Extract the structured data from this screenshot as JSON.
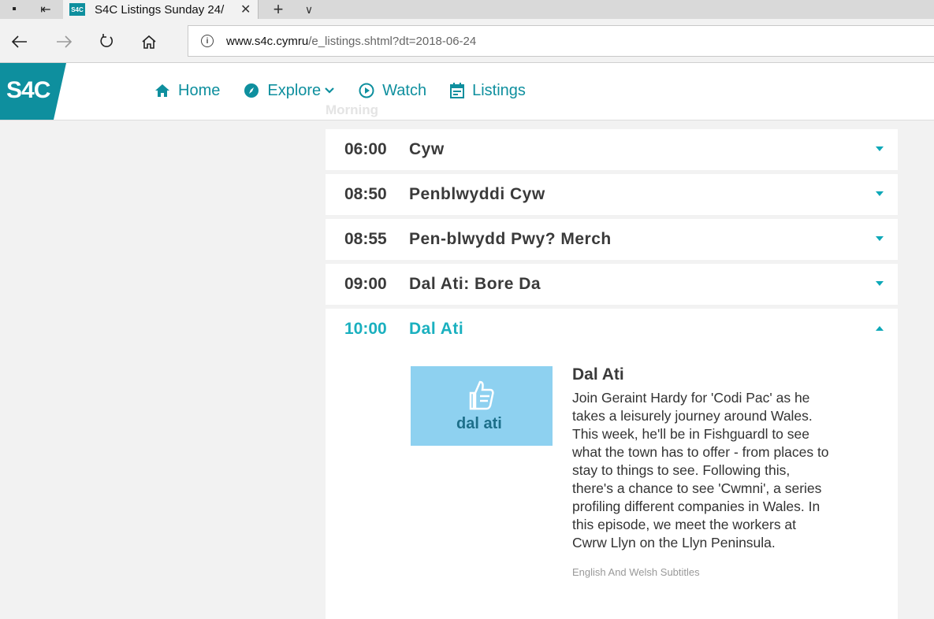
{
  "browser": {
    "tab_title": "S4C Listings Sunday 24/",
    "favicon_text": "S4C",
    "url_host": "www.s4c.cymru",
    "url_path": "/e_listings.shtml?dt=2018-06-24"
  },
  "site": {
    "logo": "S4C",
    "nav": [
      {
        "label": "Home",
        "icon": "home-icon"
      },
      {
        "label": "Explore",
        "icon": "compass-icon"
      },
      {
        "label": "Watch",
        "icon": "play-circle-icon"
      },
      {
        "label": "Listings",
        "icon": "calendar-icon"
      }
    ],
    "section_label": "Morning",
    "brand_color": "#0e8f9e",
    "highlight_color": "#1ab0bf"
  },
  "listings": [
    {
      "time": "06:00",
      "title": "Cyw"
    },
    {
      "time": "08:50",
      "title": "Penblwyddi Cyw"
    },
    {
      "time": "08:55",
      "title": "Pen-blwydd Pwy? Merch"
    },
    {
      "time": "09:00",
      "title": "Dal Ati: Bore Da"
    },
    {
      "time": "10:00",
      "title": "Dal Ati"
    }
  ],
  "detail": {
    "image_text": "dal ati",
    "title": "Dal Ati",
    "description": "Join Geraint Hardy for 'Codi Pac' as he takes a leisurely journey around Wales. This week, he'll be in Fishguardl to see what the town has to offer - from places to stay to things to see. Following this, there's a chance to see 'Cwmni', a series profiling different companies in Wales. In this episode, we meet the workers at Cwrw Llyn on the Llyn Peninsula.",
    "subtitles": "English And Welsh Subtitles"
  }
}
